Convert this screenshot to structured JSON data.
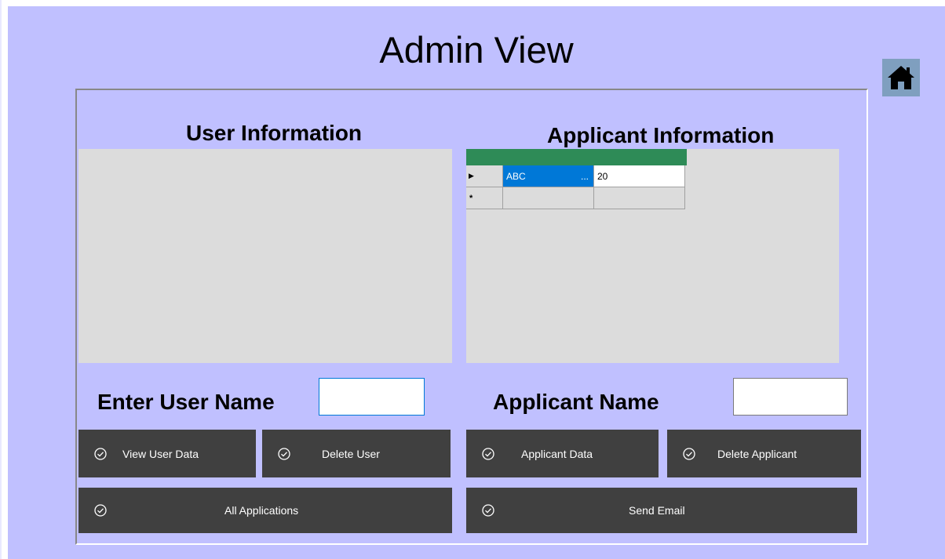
{
  "window": {
    "title": "Admin View"
  },
  "user_section": {
    "heading": "User Information",
    "input_label": "Enter User Name",
    "input_value": ""
  },
  "applicant_section": {
    "heading": "Applicant Information",
    "input_label": "Applicant Name",
    "input_value": "",
    "grid": {
      "rows": [
        {
          "marker": "▶",
          "cells": [
            "ABC",
            "20"
          ],
          "selected_cell_ellipsis": "..."
        },
        {
          "marker": "*",
          "cells": [
            "",
            ""
          ]
        }
      ]
    }
  },
  "buttons": {
    "view_user_data": "View User Data",
    "delete_user": "Delete User",
    "applicant_data": "Applicant Data",
    "delete_applicant": "Delete Applicant",
    "all_applications": "All Applications",
    "send_email": "Send Email"
  },
  "icons": {
    "home": "home-icon",
    "check": "check-circle-icon"
  },
  "colors": {
    "form_background": "#c0c0ff",
    "button_background": "#404040",
    "grid_header": "#2e8b57",
    "selection": "#0078d7"
  }
}
